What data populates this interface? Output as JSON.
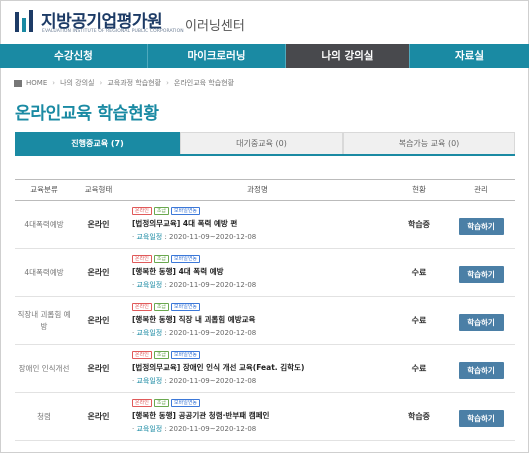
{
  "header": {
    "logo_title": "지방공기업평가원",
    "logo_subtitle": "EVALUATION INSTITUTE OF REGIONAL PUBLIC CORPORATION",
    "center_label": "이러닝센터"
  },
  "nav": {
    "items": [
      {
        "label": "수강신청"
      },
      {
        "label": "마이크로러닝"
      },
      {
        "label": "나의 강의실"
      },
      {
        "label": "자료실"
      }
    ],
    "active_index": 2
  },
  "breadcrumb": [
    "HOME",
    "나의 강의실",
    "교육과정 학습현황",
    "온라인교육 학습현황"
  ],
  "page_title": "온라인교육 학습현황",
  "tabs": [
    {
      "label": "진행중교육 (7)"
    },
    {
      "label": "대기중교육 (0)"
    },
    {
      "label": "복습가능 교육 (0)"
    }
  ],
  "table": {
    "headers": [
      "교육분류",
      "교육형태",
      "과정명",
      "현황",
      "관리"
    ],
    "badge_labels": {
      "required": "온라인",
      "level": "초급",
      "mobile": "모바일연동"
    },
    "period_label": "교육일정",
    "rows": [
      {
        "category": "4대폭력예방",
        "type": "온라인",
        "title": "[법정의무교육] 4대 폭력 예방 편",
        "period": "2020-11-09~2020-12-08",
        "status": "학습중",
        "action": "학습하기"
      },
      {
        "category": "4대폭력예방",
        "type": "온라인",
        "title": "[행복한 동행] 4대 폭력 예방",
        "period": "2020-11-09~2020-12-08",
        "status": "수료",
        "action": "학습하기"
      },
      {
        "category": "직장내 괴롭힘 예방",
        "type": "온라인",
        "title": "[행복한 동행] 직장 내 괴롭힘 예방교육",
        "period": "2020-11-09~2020-12-08",
        "status": "수료",
        "action": "학습하기"
      },
      {
        "category": "장애인 인식개선",
        "type": "온라인",
        "title": "[법정의무교육] 장애인 인식 개선 교육(Feat. 김학도)",
        "period": "2020-11-09~2020-12-08",
        "status": "수료",
        "action": "학습하기"
      },
      {
        "category": "청렴",
        "type": "온라인",
        "title": "[행복한 동행] 공공기관 청렴·반부패 캠페인",
        "period": "2020-11-09~2020-12-08",
        "status": "학습중",
        "action": "학습하기"
      }
    ]
  }
}
